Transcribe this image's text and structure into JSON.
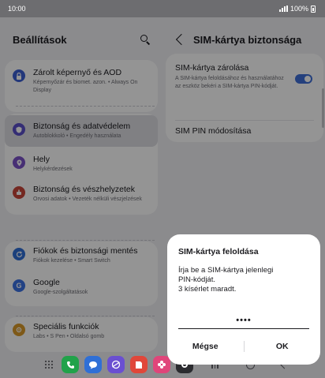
{
  "status_bar": {
    "time": "10:00",
    "battery": "100%"
  },
  "settings": {
    "title": "Beállítások",
    "items": [
      {
        "title": "Zárolt képernyő és AOD",
        "subtitle": "Képernyőzár és biomet. azon.  •  Always On Display",
        "icon": "lock-icon",
        "color": "#3c5fd3"
      },
      {
        "title": "Biztonság és adatvédelem",
        "subtitle": "Autoblokkoló  •  Engedély használata",
        "icon": "shield-icon",
        "color": "#5a4ec8"
      },
      {
        "title": "Hely",
        "subtitle": "Helykérdezések",
        "icon": "location-pin-icon",
        "color": "#7b52c9"
      },
      {
        "title": "Biztonság és vészhelyzetek",
        "subtitle": "Orvosi adatok  •  Vezeték nélküli vészjelzések",
        "icon": "emergency-icon",
        "color": "#c9453a"
      },
      {
        "title": "Fiókok és biztonsági mentés",
        "subtitle": "Fiókok kezelése  •  Smart Switch",
        "icon": "sync-icon",
        "color": "#2f6fd6"
      },
      {
        "title": "Google",
        "subtitle": "Google-szolgáltatások",
        "icon": "google-icon",
        "color": "#3b72e3"
      },
      {
        "title": "Speciális funkciók",
        "subtitle": "Labs  •  S Pen  •  Oldalsó gomb",
        "icon": "advanced-features-icon",
        "color": "#d99a2a"
      }
    ]
  },
  "sim_security": {
    "title": "SIM-kártya biztonsága",
    "lock": {
      "title": "SIM-kártya zárolása",
      "description": "A SIM-kártya feloldásához és használatához az eszköz bekéri a SIM-kártya PIN-kódját.",
      "enabled": true
    },
    "change_pin": "SIM PIN módosítása"
  },
  "dialog": {
    "title": "SIM-kártya feloldása",
    "message_line1": "Írja be a SIM-kártya jelenlegi",
    "message_line2": "PIN-kódját.",
    "message_line3": "3 kísérlet maradt.",
    "pin_value": "••••",
    "cancel": "Mégse",
    "ok": "OK"
  },
  "taskbar": {
    "apps": [
      {
        "name": "phone-app-icon",
        "color": "#21a24a"
      },
      {
        "name": "messages-app-icon",
        "color": "#2f6fd6"
      },
      {
        "name": "internet-app-icon",
        "color": "#6a4fd1"
      },
      {
        "name": "notes-app-icon",
        "color": "#e0473a"
      },
      {
        "name": "gallery-app-icon",
        "color": "#e0457a"
      },
      {
        "name": "camera-app-icon",
        "color": "#2b2b2f"
      }
    ]
  }
}
